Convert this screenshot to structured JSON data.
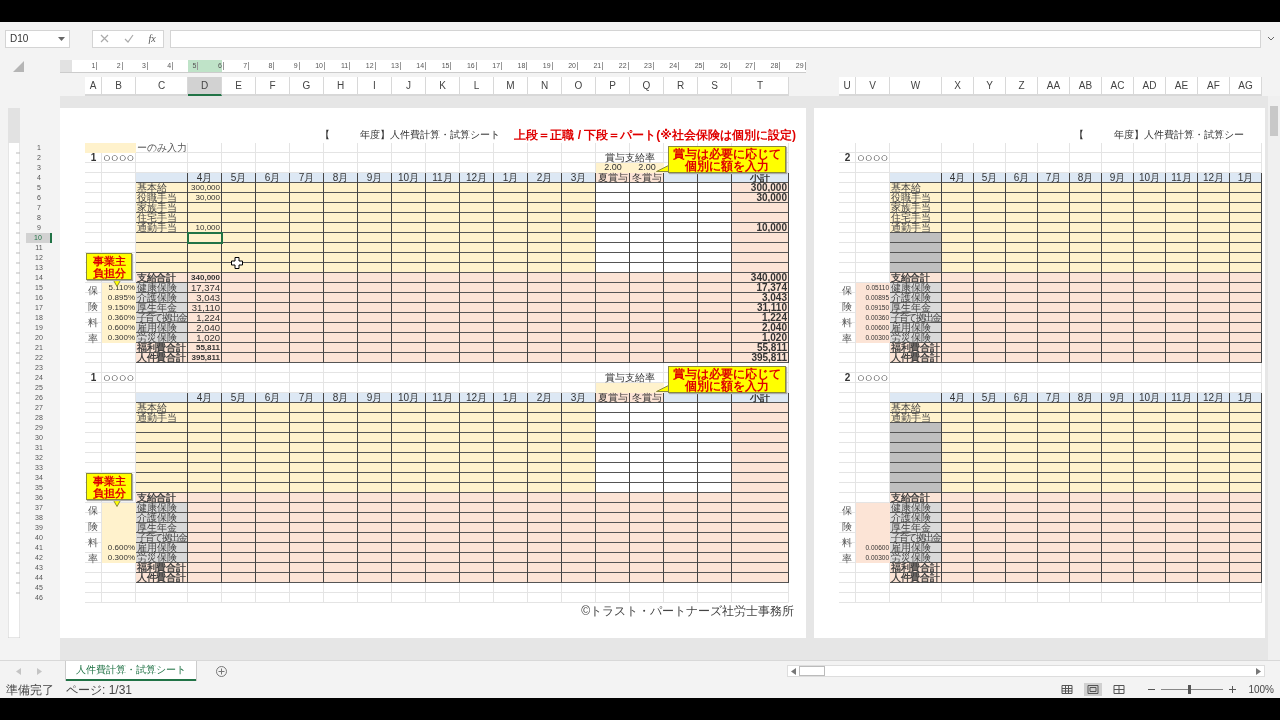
{
  "formula_bar": {
    "name_box": "D10",
    "function_label": "fx"
  },
  "ruler": [
    "1",
    "2",
    "3",
    "4",
    "5",
    "6",
    "7",
    "8",
    "9",
    "10",
    "11",
    "12",
    "13",
    "14",
    "15",
    "16",
    "17",
    "18",
    "19",
    "20",
    "21",
    "22",
    "23",
    "24",
    "25",
    "26",
    "27",
    "28",
    "29"
  ],
  "columns_left": [
    {
      "label": "A",
      "selected": false
    },
    {
      "label": "B",
      "selected": false
    },
    {
      "label": "C",
      "selected": false
    },
    {
      "label": "D",
      "selected": true
    },
    {
      "label": "E",
      "selected": false
    },
    {
      "label": "F",
      "selected": false
    },
    {
      "label": "G",
      "selected": false
    },
    {
      "label": "H",
      "selected": false
    },
    {
      "label": "I",
      "selected": false
    },
    {
      "label": "J",
      "selected": false
    },
    {
      "label": "K",
      "selected": false
    },
    {
      "label": "L",
      "selected": false
    },
    {
      "label": "M",
      "selected": false
    },
    {
      "label": "N",
      "selected": false
    },
    {
      "label": "O",
      "selected": false
    },
    {
      "label": "P",
      "selected": false
    },
    {
      "label": "Q",
      "selected": false
    },
    {
      "label": "R",
      "selected": false
    },
    {
      "label": "S",
      "selected": false
    },
    {
      "label": "T",
      "selected": false
    }
  ],
  "columns_right": [
    {
      "label": "U",
      "selected": false
    },
    {
      "label": "V",
      "selected": false
    },
    {
      "label": "W",
      "selected": false
    },
    {
      "label": "X",
      "selected": false
    },
    {
      "label": "Y",
      "selected": false
    },
    {
      "label": "Z",
      "selected": false
    },
    {
      "label": "AA",
      "selected": false
    },
    {
      "label": "AB",
      "selected": false
    },
    {
      "label": "AC",
      "selected": false
    },
    {
      "label": "AD",
      "selected": false
    },
    {
      "label": "AE",
      "selected": false
    },
    {
      "label": "AF",
      "selected": false
    },
    {
      "label": "AG",
      "selected": false
    }
  ],
  "rows": [
    {
      "label": "1",
      "selected": false
    },
    {
      "label": "2",
      "selected": false
    },
    {
      "label": "3",
      "selected": false
    },
    {
      "label": "4",
      "selected": false
    },
    {
      "label": "5",
      "selected": false
    },
    {
      "label": "6",
      "selected": false
    },
    {
      "label": "7",
      "selected": false
    },
    {
      "label": "8",
      "selected": false
    },
    {
      "label": "9",
      "selected": false
    },
    {
      "label": "10",
      "selected": true
    },
    {
      "label": "11",
      "selected": false
    },
    {
      "label": "12",
      "selected": false
    },
    {
      "label": "13",
      "selected": false
    },
    {
      "label": "14",
      "selected": false
    },
    {
      "label": "15",
      "selected": false
    },
    {
      "label": "16",
      "selected": false
    },
    {
      "label": "17",
      "selected": false
    },
    {
      "label": "18",
      "selected": false
    },
    {
      "label": "19",
      "selected": false
    },
    {
      "label": "20",
      "selected": false
    },
    {
      "label": "21",
      "selected": false
    },
    {
      "label": "22",
      "selected": false
    },
    {
      "label": "23",
      "selected": false
    },
    {
      "label": "24",
      "selected": false
    },
    {
      "label": "25",
      "selected": false
    },
    {
      "label": "26",
      "selected": false
    },
    {
      "label": "27",
      "selected": false
    },
    {
      "label": "28",
      "selected": false
    },
    {
      "label": "29",
      "selected": false
    },
    {
      "label": "30",
      "selected": false
    },
    {
      "label": "31",
      "selected": false
    },
    {
      "label": "32",
      "selected": false
    },
    {
      "label": "33",
      "selected": false
    },
    {
      "label": "34",
      "selected": false
    },
    {
      "label": "35",
      "selected": false
    },
    {
      "label": "36",
      "selected": false
    },
    {
      "label": "37",
      "selected": false
    },
    {
      "label": "38",
      "selected": false
    },
    {
      "label": "39",
      "selected": false
    },
    {
      "label": "40",
      "selected": false
    },
    {
      "label": "41",
      "selected": false
    },
    {
      "label": "42",
      "selected": false
    },
    {
      "label": "43",
      "selected": false
    },
    {
      "label": "44",
      "selected": false
    },
    {
      "label": "45",
      "selected": false
    },
    {
      "label": "46",
      "selected": false
    }
  ],
  "pages": [
    {
      "kind": "main",
      "title": "【　　　年度】人件費計算・試算シート",
      "notice": "上段＝正職 / 下段＝パート(※社会保険は個別に設定)",
      "input_note": "ーのみ入力",
      "footer": "©トラスト・パートナーズ社労士事務所",
      "blocks": [
        {
          "number": "1",
          "name": "○○○○",
          "bonus_rate_label": "賞与支給率",
          "bonus_rates": [
            "2.00",
            "2.00"
          ],
          "bonus_note": [
            "賞与は必要に応じて",
            "個別に額を入力"
          ],
          "employer_note": [
            "事業主",
            "負担分"
          ],
          "insurance_label": "保険料率",
          "months": [
            "4月",
            "5月",
            "6月",
            "7月",
            "8月",
            "9月",
            "10月",
            "11月",
            "12月",
            "1月",
            "2月",
            "3月"
          ],
          "bonus_columns": [
            "夏賞与",
            "冬賞与"
          ],
          "subtotal_label": "小計",
          "rows": [
            {
              "kind": "pay",
              "label": "基本給",
              "first": "300,000",
              "subtotal": "300,000"
            },
            {
              "kind": "pay",
              "label": "役職手当",
              "first": "30,000",
              "subtotal": "30,000"
            },
            {
              "kind": "pay",
              "label": "家族手当"
            },
            {
              "kind": "pay",
              "label": "住宅手当"
            },
            {
              "kind": "pay",
              "label": "通勤手当",
              "first": "10,000",
              "subtotal": "10,000"
            },
            {
              "kind": "pay"
            },
            {
              "kind": "pay"
            },
            {
              "kind": "pay"
            },
            {
              "kind": "pay"
            },
            {
              "kind": "total",
              "label": "支給合計",
              "first": "340,000",
              "subtotal": "340,000"
            },
            {
              "kind": "insurance",
              "label": "健康保険",
              "rate": "5.110%",
              "first": "17,374",
              "subtotal": "17,374"
            },
            {
              "kind": "insurance",
              "label": "介護保険",
              "rate": "0.895%",
              "first": "3,043",
              "subtotal": "3,043"
            },
            {
              "kind": "insurance",
              "label": "厚生年金",
              "rate": "9.150%",
              "first": "31,110",
              "subtotal": "31,110"
            },
            {
              "kind": "insurance",
              "label": "子育て拠出金",
              "rate": "0.360%",
              "first": "1,224",
              "subtotal": "1,224"
            },
            {
              "kind": "insurance",
              "label": "雇用保険",
              "rate": "0.600%",
              "first": "2,040",
              "subtotal": "2,040"
            },
            {
              "kind": "insurance",
              "label": "労災保険",
              "rate": "0.300%",
              "first": "1,020",
              "subtotal": "1,020"
            },
            {
              "kind": "total",
              "label": "福利費合計",
              "first": "55,811",
              "subtotal": "55,811"
            },
            {
              "kind": "total",
              "label": "人件費合計",
              "first": "395,811",
              "subtotal": "395,811"
            }
          ]
        },
        {
          "number": "1",
          "name": "○○○○",
          "bonus_rate_label": "賞与支給率",
          "bonus_note": [
            "賞与は必要に応じて",
            "個別に額を入力"
          ],
          "employer_note": [
            "事業主",
            "負担分"
          ],
          "insurance_label": "保険料率",
          "months": [
            "4月",
            "5月",
            "6月",
            "7月",
            "8月",
            "9月",
            "10月",
            "11月",
            "12月",
            "1月",
            "2月",
            "3月"
          ],
          "bonus_columns": [
            "夏賞与",
            "冬賞与"
          ],
          "subtotal_label": "小計",
          "rows": [
            {
              "kind": "pay",
              "label": "基本給"
            },
            {
              "kind": "pay",
              "label": "通勤手当"
            },
            {
              "kind": "pay"
            },
            {
              "kind": "pay"
            },
            {
              "kind": "pay"
            },
            {
              "kind": "pay"
            },
            {
              "kind": "pay"
            },
            {
              "kind": "pay"
            },
            {
              "kind": "pay"
            },
            {
              "kind": "total",
              "label": "支給合計"
            },
            {
              "kind": "insurance",
              "label": "健康保険"
            },
            {
              "kind": "insurance",
              "label": "介護保険"
            },
            {
              "kind": "insurance",
              "label": "厚生年金"
            },
            {
              "kind": "insurance",
              "label": "子育て拠出金"
            },
            {
              "kind": "insurance",
              "label": "雇用保険",
              "rate": "0.600%"
            },
            {
              "kind": "insurance",
              "label": "労災保険",
              "rate": "0.300%"
            },
            {
              "kind": "total",
              "label": "福利費合計"
            },
            {
              "kind": "total",
              "label": "人件費合計"
            }
          ]
        }
      ]
    },
    {
      "kind": "copy",
      "title": "【　　　年度】人件費計算・試算シー",
      "blocks": [
        {
          "number": "2",
          "name": "○○○○",
          "insurance_label": "保険料率",
          "months": [
            "4月",
            "5月",
            "6月",
            "7月",
            "8月",
            "9月",
            "10月",
            "11月",
            "12月",
            "1月"
          ],
          "rows": [
            {
              "kind": "pay",
              "label": "基本給"
            },
            {
              "kind": "pay",
              "label": "役職手当"
            },
            {
              "kind": "pay",
              "label": "家族手当"
            },
            {
              "kind": "pay",
              "label": "住宅手当"
            },
            {
              "kind": "pay",
              "label": "通勤手当"
            },
            {
              "kind": "pay"
            },
            {
              "kind": "pay"
            },
            {
              "kind": "pay"
            },
            {
              "kind": "pay"
            },
            {
              "kind": "total",
              "label": "支給合計"
            },
            {
              "kind": "insurance",
              "label": "健康保険",
              "rate": "0.05110"
            },
            {
              "kind": "insurance",
              "label": "介護保険",
              "rate": "0.00895"
            },
            {
              "kind": "insurance",
              "label": "厚生年金",
              "rate": "0.09150"
            },
            {
              "kind": "insurance",
              "label": "子育て拠出金",
              "rate": "0.00360"
            },
            {
              "kind": "insurance",
              "label": "雇用保険",
              "rate": "0.00600"
            },
            {
              "kind": "insurance",
              "label": "労災保険",
              "rate": "0.00300"
            },
            {
              "kind": "total",
              "label": "福利費合計"
            },
            {
              "kind": "total",
              "label": "人件費合計"
            }
          ]
        },
        {
          "number": "2",
          "name": "○○○○",
          "insurance_label": "保険料率",
          "months": [
            "4月",
            "5月",
            "6月",
            "7月",
            "8月",
            "9月",
            "10月",
            "11月",
            "12月",
            "1月"
          ],
          "rows": [
            {
              "kind": "pay",
              "label": "基本給"
            },
            {
              "kind": "pay",
              "label": "通勤手当"
            },
            {
              "kind": "pay"
            },
            {
              "kind": "pay"
            },
            {
              "kind": "pay"
            },
            {
              "kind": "pay"
            },
            {
              "kind": "pay"
            },
            {
              "kind": "pay"
            },
            {
              "kind": "pay"
            },
            {
              "kind": "total",
              "label": "支給合計"
            },
            {
              "kind": "insurance",
              "label": "健康保険"
            },
            {
              "kind": "insurance",
              "label": "介護保険"
            },
            {
              "kind": "insurance",
              "label": "厚生年金"
            },
            {
              "kind": "insurance",
              "label": "子育て拠出金"
            },
            {
              "kind": "insurance",
              "label": "雇用保険",
              "rate": "0.00600"
            },
            {
              "kind": "insurance",
              "label": "労災保険",
              "rate": "0.00300"
            },
            {
              "kind": "total",
              "label": "福利費合計"
            },
            {
              "kind": "total",
              "label": "人件費合計"
            }
          ]
        }
      ]
    }
  ],
  "sheet_tabs": [
    {
      "label": "人件費計算・試算シート",
      "selected": true
    }
  ],
  "status": {
    "text": "準備完了",
    "page": "ページ: 1/31"
  },
  "views": [
    {
      "kind": "normal",
      "selected": false
    },
    {
      "kind": "page_layout",
      "selected": true
    },
    {
      "kind": "page_break",
      "selected": false
    }
  ],
  "zoom": {
    "label": "100%",
    "level": 0.45
  }
}
